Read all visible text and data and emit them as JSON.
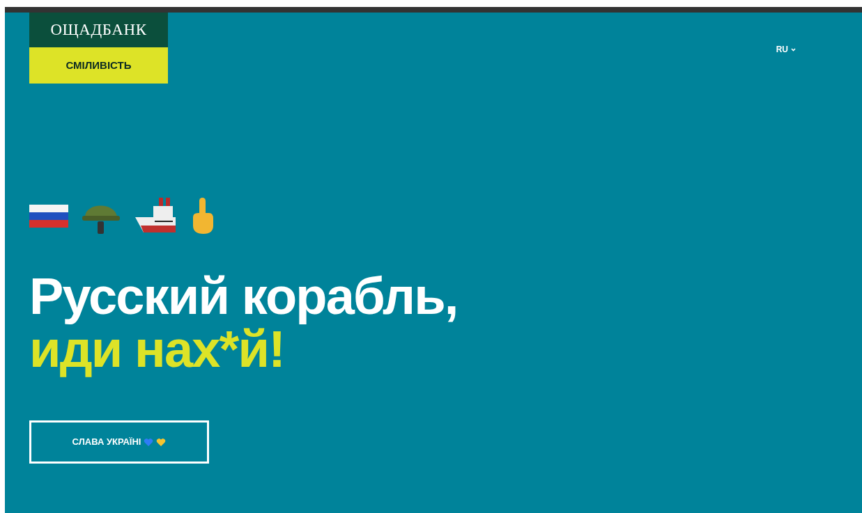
{
  "logo": {
    "name": "ОЩАДБАНК",
    "tagline": "СМІЛИВІСТЬ"
  },
  "language": {
    "label": "RU"
  },
  "headline": {
    "line_1": "Русский корабль,",
    "line_2": "иди нах*й!"
  },
  "cta_button": {
    "label": "СЛАВА УКРАЇНІ"
  }
}
